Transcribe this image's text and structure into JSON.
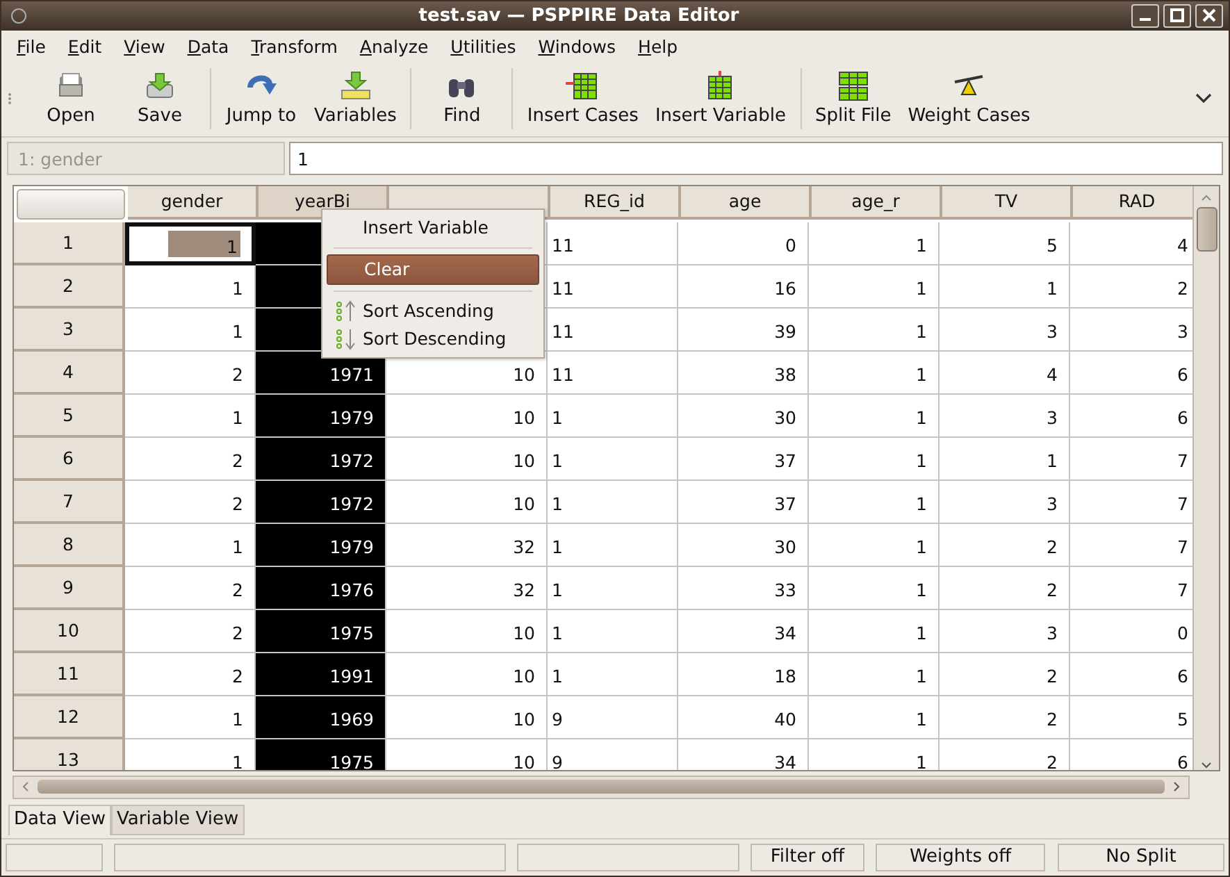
{
  "window": {
    "title": "test.sav — PSPPIRE Data Editor"
  },
  "menubar": [
    "File",
    "Edit",
    "View",
    "Data",
    "Transform",
    "Analyze",
    "Utilities",
    "Windows",
    "Help"
  ],
  "toolbar": [
    {
      "kind": "open",
      "label": "Open"
    },
    {
      "kind": "save",
      "label": "Save"
    },
    {
      "kind": "jump",
      "label": "Jump to"
    },
    {
      "kind": "variables",
      "label": "Variables"
    },
    {
      "kind": "find",
      "label": "Find"
    },
    {
      "kind": "insert_cases",
      "label": "Insert Cases"
    },
    {
      "kind": "insert_variable",
      "label": "Insert Variable"
    },
    {
      "kind": "split",
      "label": "Split File"
    },
    {
      "kind": "weight",
      "label": "Weight Cases"
    }
  ],
  "entry": {
    "cell_reference": "1: gender",
    "value": "1"
  },
  "table": {
    "columns": [
      {
        "label": "gender",
        "selected": false
      },
      {
        "label": "yearBi",
        "selected": true
      },
      {
        "selected": false
      },
      {
        "label": "REG_id",
        "selected": false
      },
      {
        "label": "age",
        "selected": false
      },
      {
        "label": "age_r",
        "selected": false
      },
      {
        "label": "TV",
        "selected": false
      },
      {
        "label": "RAD",
        "selected": false
      }
    ],
    "rows": [
      {
        "label": "1",
        "cells": [
          "1",
          null,
          null,
          "11",
          "0",
          "1",
          "5",
          "4"
        ]
      },
      {
        "label": "2",
        "cells": [
          "1",
          null,
          null,
          "11",
          "16",
          "1",
          "1",
          "2"
        ]
      },
      {
        "label": "3",
        "cells": [
          "1",
          null,
          null,
          "11",
          "39",
          "1",
          "3",
          "3"
        ]
      },
      {
        "label": "4",
        "cells": [
          "2",
          "1971",
          "10",
          "11",
          "38",
          "1",
          "4",
          "6"
        ]
      },
      {
        "label": "5",
        "cells": [
          "1",
          "1979",
          "10",
          "1",
          "30",
          "1",
          "3",
          "6"
        ]
      },
      {
        "label": "6",
        "cells": [
          "2",
          "1972",
          "10",
          "1",
          "37",
          "1",
          "1",
          "7"
        ]
      },
      {
        "label": "7",
        "cells": [
          "2",
          "1972",
          "10",
          "1",
          "37",
          "1",
          "3",
          "7"
        ]
      },
      {
        "label": "8",
        "cells": [
          "1",
          "1979",
          "32",
          "1",
          "30",
          "1",
          "2",
          "7"
        ]
      },
      {
        "label": "9",
        "cells": [
          "2",
          "1976",
          "32",
          "1",
          "33",
          "1",
          "2",
          "7"
        ]
      },
      {
        "label": "10",
        "cells": [
          "2",
          "1975",
          "10",
          "1",
          "34",
          "1",
          "3",
          "0"
        ]
      },
      {
        "label": "11",
        "cells": [
          "2",
          "1991",
          "10",
          "1",
          "18",
          "1",
          "2",
          "6"
        ]
      },
      {
        "label": "12",
        "cells": [
          "1",
          "1969",
          "10",
          "9",
          "40",
          "1",
          "2",
          "5"
        ]
      },
      {
        "label": "13",
        "cells": [
          "1",
          "1975",
          "10",
          "9",
          "34",
          "1",
          "2",
          "6"
        ]
      }
    ]
  },
  "context_menu": [
    {
      "kind": "plain",
      "label": "Insert Variable",
      "selected": false
    },
    {
      "kind": "plain",
      "label": "Clear",
      "selected": true
    },
    {
      "kind": "sort_ascending",
      "label": "Sort Ascending",
      "selected": false
    },
    {
      "kind": "sort_descending",
      "label": "Sort Descending",
      "selected": false
    }
  ],
  "view_tabs": [
    {
      "label": "Data View",
      "selected": true
    },
    {
      "label": "Variable View",
      "selected": false
    }
  ],
  "status_bar": [
    "Filter off",
    "Weights off",
    "No Split"
  ]
}
